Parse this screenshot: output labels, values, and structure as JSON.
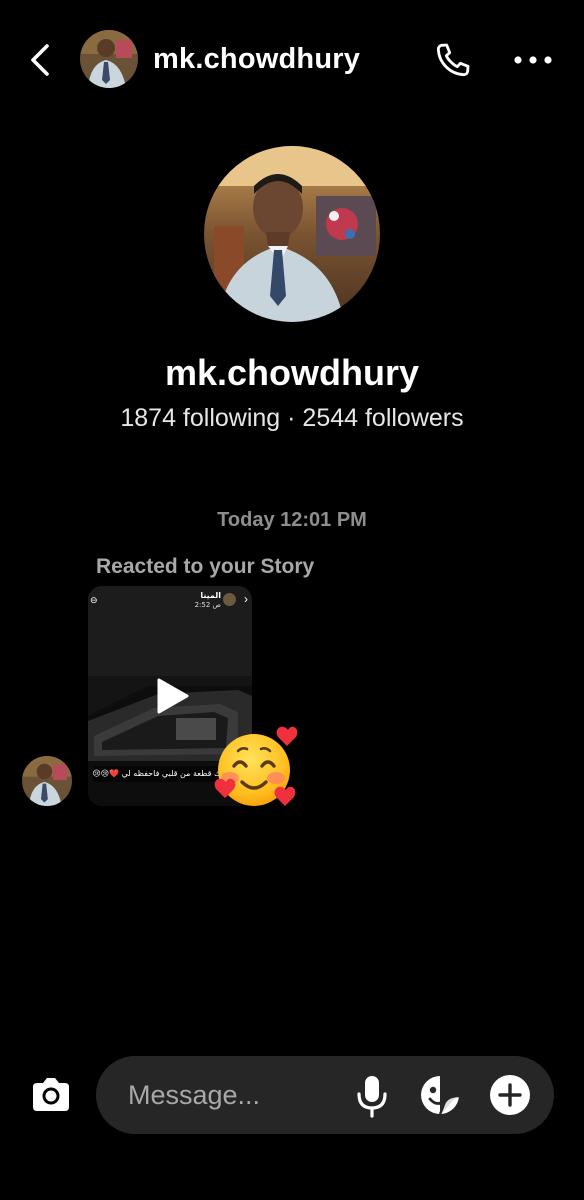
{
  "header": {
    "username": "mk.chowdhury",
    "icons": {
      "back": "chevron-left-icon",
      "call": "phone-icon",
      "more": "more-horizontal-icon"
    }
  },
  "profile": {
    "name": "mk.chowdhury",
    "stats": "1874 following · 2544 followers"
  },
  "conversation": {
    "timestamp": "Today 12:01 PM",
    "story_reaction_label": "Reacted to your Story",
    "story": {
      "username": "المينا",
      "time": "2:52 ص",
      "caption": "استودعتك قطعة من قلبي فاحفظه لي ❤️😢😢😢",
      "reaction": "smiling-face-with-hearts"
    }
  },
  "composer": {
    "placeholder": "Message...",
    "icons": {
      "camera": "camera-icon",
      "mic": "microphone-icon",
      "sticker": "sticker-icon",
      "add": "plus-circle-icon"
    }
  },
  "colors": {
    "background": "#000000",
    "composer_bg": "#262626",
    "muted_text": "#8e8e8e"
  }
}
